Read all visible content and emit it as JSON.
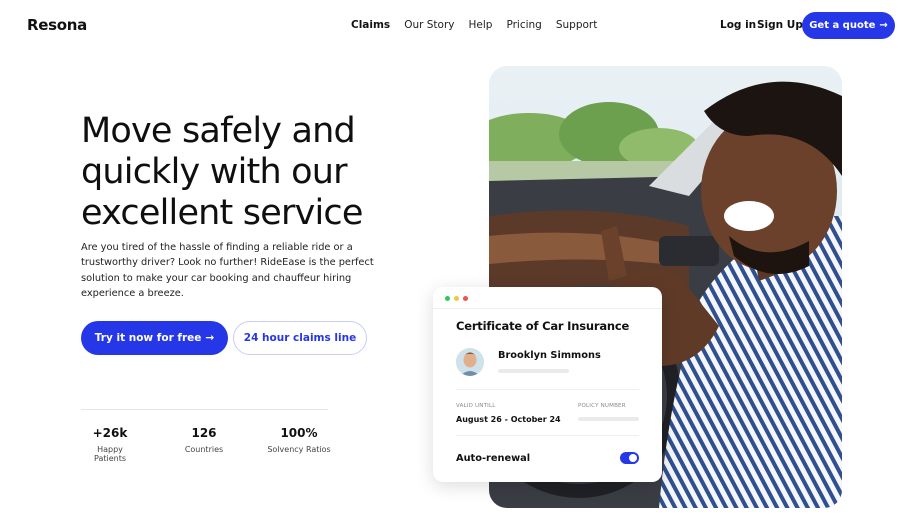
{
  "brand": {
    "name": "Resona"
  },
  "nav": {
    "items": [
      {
        "label": "Claims",
        "active": true
      },
      {
        "label": "Our Story",
        "active": false
      },
      {
        "label": "Help",
        "active": false
      },
      {
        "label": "Pricing",
        "active": false
      },
      {
        "label": "Support",
        "active": false
      }
    ],
    "login": "Log in",
    "signup": "Sign Up",
    "quote": "Get a quote",
    "quote_icon": "arrow-right-icon"
  },
  "hero": {
    "title": "Move safely and quickly with our excellent service",
    "description": "Are you tired of the hassle of finding a reliable ride or a trustworthy driver? Look no further! RideEase is the perfect solution to make your car booking and chauffeur hiring experience a breeze.",
    "primary_cta": "Try it now for free",
    "secondary_cta": "24 hour claims line"
  },
  "stats": [
    {
      "value": "+26k",
      "label": "Happy Patients"
    },
    {
      "value": "126",
      "label": "Countries"
    },
    {
      "value": "100%",
      "label": "Solvency Ratios"
    }
  ],
  "card": {
    "title": "Certificate of Car Insurance",
    "user_name": "Brooklyn Simmons",
    "valid_label": "VALID UNTILL",
    "valid_value": "August 26 - October 24",
    "policy_label": "POLICY NUMBER",
    "auto_renewal": "Auto-renewal",
    "auto_renewal_on": true
  },
  "colors": {
    "accent": "#2537e6",
    "dot_green": "#34c759",
    "dot_yellow": "#f5c542",
    "dot_red": "#ef5350"
  }
}
